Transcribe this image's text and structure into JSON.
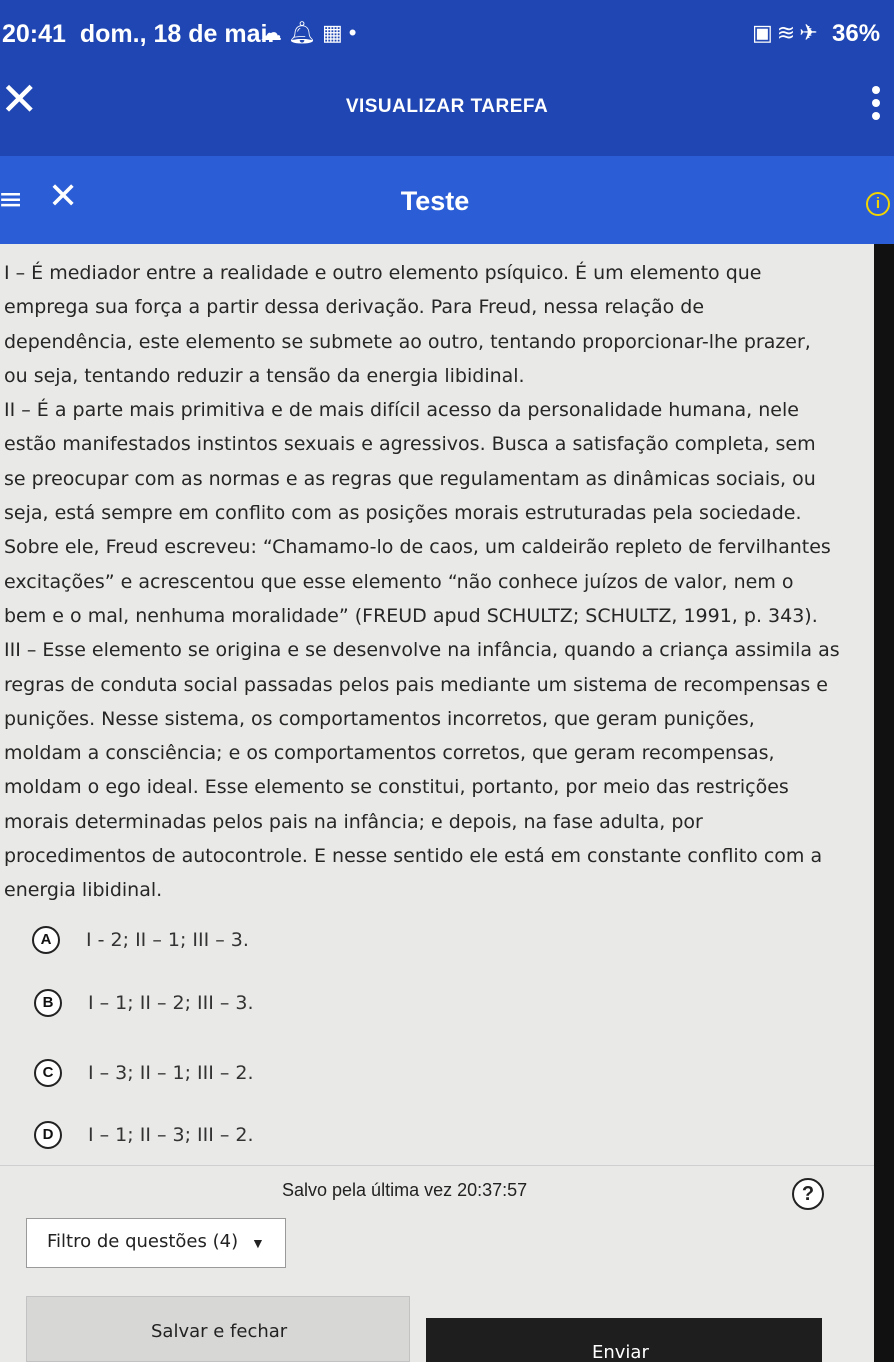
{
  "status_bar": {
    "time": "20:41",
    "date": "dom., 18 de mai.",
    "battery": "36%",
    "left_icons": [
      "cloud-icon",
      "notification-bell-icon",
      "calendar-icon",
      "dot-icon"
    ],
    "right_icons": [
      "lock-icon",
      "wifi-icon",
      "airplane-icon"
    ]
  },
  "app_bar": {
    "title": "VISUALIZAR TAREFA",
    "close_icon": "close-icon",
    "menu_icon": "more-vert-icon",
    "color": "#1f46b2"
  },
  "test_bar": {
    "title": "Teste",
    "info_badge": "i",
    "menu_icon": "hamburger-icon",
    "close_icon": "close-icon",
    "color": "#2b5dd6",
    "badge_color": "#f2d400"
  },
  "question": {
    "lines": [
      "I – É mediador entre a realidade e outro elemento psíquico. É um elemento que",
      "emprega sua força a partir dessa derivação. Para Freud, nessa relação de",
      "dependência, este elemento se submete ao outro, tentando proporcionar-lhe prazer,",
      "ou seja, tentando reduzir a tensão da energia libidinal.",
      "II – É a parte mais primitiva e de mais difícil acesso da personalidade humana, nele",
      "estão manifestados instintos sexuais e agressivos. Busca a satisfação completa, sem",
      "se preocupar com as normas e as regras que regulamentam as dinâmicas sociais, ou",
      "seja, está sempre em conflito com as posições morais estruturadas pela sociedade.",
      "Sobre ele, Freud escreveu: “Chamamo-lo de caos, um caldeirão repleto de fervilhantes",
      "excitações” e acrescentou que esse elemento “não conhece juízos de valor, nem o",
      "bem e o mal, nenhuma moralidade” (FREUD apud SCHULTZ; SCHULTZ, 1991, p. 343).",
      "III – Esse elemento se origina e se desenvolve na infância, quando a criança assimila as",
      "regras de conduta social passadas pelos pais mediante um sistema de recompensas e",
      "punições. Nesse sistema, os comportamentos incorretos, que geram punições,",
      "moldam a consciência; e os comportamentos corretos, que geram recompensas,",
      "moldam o ego ideal. Esse elemento se constitui, portanto, por meio das restrições",
      "morais determinadas pelos pais na infância; e depois, na fase adulta, por",
      "procedimentos de autocontrole. E nesse sentido ele está em constante conflito com a",
      "energia libidinal."
    ]
  },
  "options": [
    {
      "letter": "A",
      "text": "I - 2; II – 1; III – 3."
    },
    {
      "letter": "B",
      "text": "I – 1; II – 2; III – 3."
    },
    {
      "letter": "C",
      "text": "I – 3; II – 1; III – 2."
    },
    {
      "letter": "D",
      "text": "I – 1; II – 3; III – 2."
    }
  ],
  "footer": {
    "saved_label": "Salvo pela última vez",
    "saved_time": "20:37:57",
    "help_icon": "?",
    "filter_label": "Filtro de questões (4)",
    "save_button": "Salvar e fechar",
    "send_button": "Enviar"
  }
}
